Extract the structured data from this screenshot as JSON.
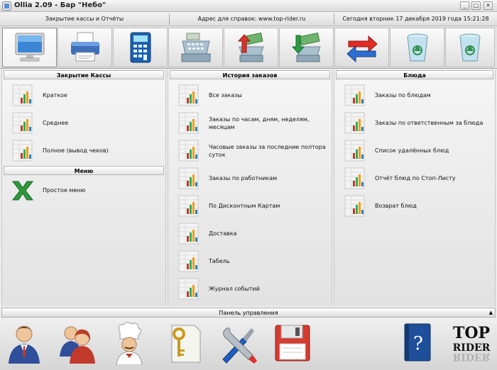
{
  "window": {
    "title": "Ollia 2.09 - Бар \"Небо\"",
    "min": "_",
    "max": "□",
    "close": "✕"
  },
  "infobar": {
    "left": "Закрытие кассы и Отчёты",
    "center": "Адрес для справок: www.top-rider.ru",
    "right": "Сегодня  вторник  17 декабря 2019 года   15:21:28"
  },
  "toolbar": {
    "icons": [
      "monitor-icon",
      "printer-icon",
      "calculator-icon",
      "cash-register-icon",
      "money-up-icon",
      "money-down-icon",
      "transfer-arrows-icon",
      "recycle-bin-icon",
      "recycle-bin-icon"
    ]
  },
  "panels": {
    "closing": {
      "title": "Закрытие Кассы",
      "items": [
        "Краткое",
        "Среднее",
        "Полное (вывод чеков)"
      ]
    },
    "menu": {
      "title": "Меню",
      "items": [
        "Простое меню"
      ]
    },
    "orders": {
      "title": "История заказов",
      "items": [
        "Все заказы",
        "Заказы по часам, дням, неделям, месяцам",
        "Часовые заказы за последние полтора суток",
        "Заказы по работникам",
        "По Дисконтным Картам",
        "Доставка",
        "Табель",
        "Журнал событий"
      ]
    },
    "dishes": {
      "title": "Блюда",
      "items": [
        "Заказы по блюдам",
        "Заказы по ответственным за блюда",
        "Список удалённых блюд",
        "Отчёт блюд по Стоп-Листу",
        "Возврат блюд"
      ]
    }
  },
  "control_panel": {
    "label": "Панель управления",
    "toggle": "▲"
  },
  "bottom": {
    "icons": [
      "user-icon",
      "staff-group-icon",
      "chef-icon",
      "key-document-icon",
      "tools-icon",
      "save-disk-icon",
      "help-book-icon",
      "top-rider-logo"
    ],
    "logo_text": "TOP RIDER"
  }
}
